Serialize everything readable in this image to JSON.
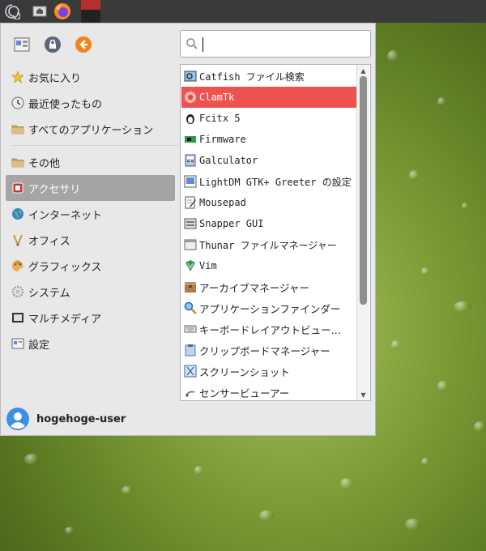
{
  "panel": {
    "items": [
      "whisker-menu-icon",
      "desktop-icon",
      "firefox-icon",
      "active-window"
    ]
  },
  "menu": {
    "toolbar": [
      "settings-manager-icon",
      "lock-icon",
      "logout-icon"
    ],
    "search": {
      "value": "",
      "placeholder": ""
    },
    "categories": [
      {
        "label": "お気に入り",
        "icon": "star-icon"
      },
      {
        "label": "最近使ったもの",
        "icon": "history-icon"
      },
      {
        "label": "すべてのアプリケーション",
        "icon": "folder-icon"
      },
      {
        "label": "その他",
        "icon": "folder-icon"
      },
      {
        "label": "アクセサリ",
        "icon": "accessories-icon",
        "selected": true
      },
      {
        "label": "インターネット",
        "icon": "globe-icon"
      },
      {
        "label": "オフィス",
        "icon": "office-icon"
      },
      {
        "label": "グラフィックス",
        "icon": "palette-icon"
      },
      {
        "label": "システム",
        "icon": "gear-icon"
      },
      {
        "label": "マルチメディア",
        "icon": "multimedia-icon"
      },
      {
        "label": "設定",
        "icon": "settings-icon"
      }
    ],
    "apps": [
      {
        "label": "Catfish ファイル検索",
        "icon": "catfish-icon"
      },
      {
        "label": "ClamTk",
        "icon": "clamtk-icon",
        "selected": true
      },
      {
        "label": "Fcitx 5",
        "icon": "penguin-icon"
      },
      {
        "label": "Firmware",
        "icon": "chip-icon"
      },
      {
        "label": "Galculator",
        "icon": "calculator-icon"
      },
      {
        "label": "LightDM GTK+ Greeter の設定",
        "icon": "lightdm-icon"
      },
      {
        "label": "Mousepad",
        "icon": "text-editor-icon"
      },
      {
        "label": "Snapper GUI",
        "icon": "snapper-icon"
      },
      {
        "label": "Thunar ファイルマネージャー",
        "icon": "file-manager-icon"
      },
      {
        "label": "Vim",
        "icon": "vim-icon"
      },
      {
        "label": "アーカイブマネージャー",
        "icon": "archive-icon"
      },
      {
        "label": "アプリケーションファインダー",
        "icon": "magnifier-icon"
      },
      {
        "label": "キーボードレイアウトビュー…",
        "icon": "keyboard-icon"
      },
      {
        "label": "クリップボードマネージャー",
        "icon": "clipboard-icon"
      },
      {
        "label": "スクリーンショット",
        "icon": "screenshot-icon"
      },
      {
        "label": "センサービューアー",
        "icon": "sensor-icon"
      }
    ],
    "user": "hogehoge-user"
  }
}
